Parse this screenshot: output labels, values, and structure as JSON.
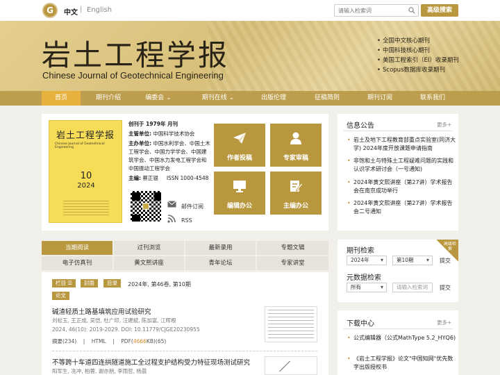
{
  "header": {
    "lang_zh": "中文",
    "lang_sep": "|",
    "lang_en": "English",
    "search_placeholder": "请输入检索词",
    "adv_search": "高级搜索"
  },
  "banner": {
    "title_cn": "岩土工程学报",
    "title_en": "Chinese Journal of Geotechnical Engineering",
    "indexes": [
      "全国中文核心期刊",
      "中国科技核心期刊",
      "美国工程索引（EI）收录期刊",
      "Scopus数据库收录期刊"
    ]
  },
  "nav": {
    "items": [
      "首页",
      "期刊介绍",
      "编委会",
      "期刊在线",
      "出版伦理",
      "征稿简则",
      "期刊订阅",
      "联系我们"
    ]
  },
  "cover": {
    "title": "岩土工程学报",
    "title_en": "Chinese Journal of Geotechnical Engineering",
    "issue": "10",
    "year": "2024"
  },
  "journal_info": {
    "founded": "创刊于 1979年 月刊",
    "sponsor_label": "主管单位:",
    "sponsor": "中国科学技术协会",
    "host_label": "主办单位:",
    "host": "中国水利学会、中国土木工程学会、中国力学学会、中国建筑学会、中国水力发电工程学会和中国振动工程学会",
    "editor_label": "主编:",
    "editor": "蔡正银",
    "issn": "ISSN 1000-4548",
    "subscribe": "邮件订阅",
    "rss": "RSS"
  },
  "tiles": {
    "author": "作者投稿",
    "reviewer": "专家审稿",
    "editor": "编辑办公",
    "chief": "主编办公"
  },
  "tabs": {
    "row1": [
      "当期阅读",
      "过刊浏览",
      "最新录用",
      "专题文辑"
    ],
    "row2": [
      "电子仿真刊",
      "黄文熙讲座",
      "青年论坛",
      "专家讲堂"
    ]
  },
  "article_filter": {
    "tag_column": "栏目 ☰",
    "tag_cover": "封面",
    "tag_toc": "目录",
    "issue_text": "2024年, 第46卷, 第10期",
    "tag_paper": "论文"
  },
  "articles": [
    {
      "title": "碱渣轻质土路基填筑应用试验研究",
      "authors": "刘松玉, 王正成, 吴恺, 杜广印, 汪建斌, 陈加富, 江晖根",
      "citation": "2024, 46(10): 2019-2029. DOI: 10.11779/CJGE20230955",
      "abstract_label": "摘要(234)",
      "html_label": "HTML",
      "pdf_prefix": "PDF(",
      "pdf_size": "4666",
      "pdf_suffix": "KB)(65)"
    },
    {
      "title": "不等跨十车道四连拱隧道施工全过程支护结构受力特征现场测试研究",
      "authors": "阳军生, 冼冲, 柏蓉, 谢亦朋, 李雨哲, 杨晨"
    }
  ],
  "notices": {
    "title": "信息公告",
    "more": "更多+",
    "items": [
      "岩土及地下工程教育部重点实验室(同济大学) 2024年度开放课题申请指南",
      "非饱和土与特殊土工程疑难问题的实践和认识学术研讨会（一号通知)",
      "2024年黄文熙讲座（第27讲）学术报告会在南京成功举行",
      "2024年黄文熙讲座（第27讲）学术报告会二号通知"
    ]
  },
  "journal_search": {
    "title": "期刊检索",
    "badge": "高级检索",
    "year": "2024年",
    "issue": "第10期",
    "submit": "提交"
  },
  "meta_search": {
    "title": "元数据检索",
    "scope": "所有",
    "placeholder": "请输入检索词",
    "submit": "提交"
  },
  "downloads": {
    "title": "下载中心",
    "more": "更多+",
    "items": [
      "公式编辑器（公式MathType 5.2_HYQ6)",
      "《岩土工程学报》论文\"中国知网\"优先数字出版授权书"
    ]
  },
  "colors": {
    "gold": "#b8973f",
    "nav_active": "#e6b13d",
    "banner": "#dcc47f"
  }
}
